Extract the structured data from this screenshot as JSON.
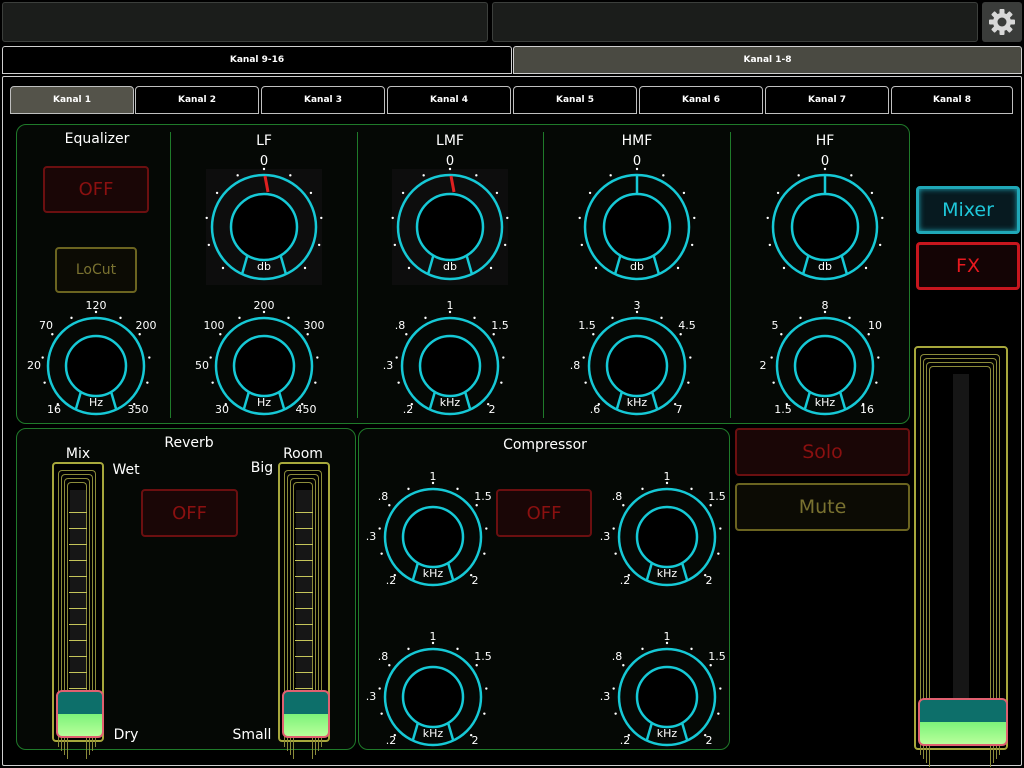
{
  "header": {
    "settings_icon": "gear-icon"
  },
  "group_tabs": [
    {
      "label": "Kanal 9-16",
      "active": false
    },
    {
      "label": "Kanal 1-8",
      "active": true
    }
  ],
  "channel_tabs": [
    "Kanal 1",
    "Kanal 2",
    "Kanal 3",
    "Kanal 4",
    "Kanal 5",
    "Kanal 6",
    "Kanal 7",
    "Kanal 8"
  ],
  "equalizer": {
    "title": "Equalizer",
    "off_label": "OFF",
    "locut_label": "LoCut",
    "freq_knob": {
      "unit": "Hz",
      "ticks": [
        "20",
        "70",
        "120",
        "200",
        "16",
        "350"
      ]
    },
    "bands": [
      {
        "name": "LF",
        "gain_value": "0",
        "gain_unit": "db",
        "freq_unit": "Hz",
        "freq_ticks": [
          "50",
          "100",
          "200",
          "300",
          "30",
          "450"
        ]
      },
      {
        "name": "LMF",
        "gain_value": "0",
        "gain_unit": "db",
        "freq_unit": "kHz",
        "freq_ticks": [
          ".3",
          ".8",
          "1",
          "1.5",
          ".2",
          "2"
        ]
      },
      {
        "name": "HMF",
        "gain_value": "0",
        "gain_unit": "db",
        "freq_unit": "kHz",
        "freq_ticks": [
          ".8",
          "1.5",
          "3",
          "4.5",
          ".6",
          "7"
        ]
      },
      {
        "name": "HF",
        "gain_value": "0",
        "gain_unit": "db",
        "freq_unit": "kHz",
        "freq_ticks": [
          "2",
          "5",
          "8",
          "10",
          "1.5",
          "16"
        ]
      }
    ]
  },
  "reverb": {
    "title": "Reverb",
    "off_label": "OFF",
    "mix": {
      "label": "Mix",
      "top": "Wet",
      "bottom": "Dry"
    },
    "room": {
      "label": "Room",
      "top": "Big",
      "bottom": "Small"
    }
  },
  "compressor": {
    "title": "Compressor",
    "off_label": "OFF",
    "knobs": [
      {
        "unit": "kHz",
        "ticks": [
          ".3",
          ".8",
          "1",
          "1.5",
          ".2",
          "2"
        ]
      },
      {
        "unit": "kHz",
        "ticks": [
          ".3",
          ".8",
          "1",
          "1.5",
          ".2",
          "2"
        ]
      },
      {
        "unit": "kHz",
        "ticks": [
          ".3",
          ".8",
          "1",
          "1.5",
          ".2",
          "2"
        ]
      },
      {
        "unit": "kHz",
        "ticks": [
          ".3",
          ".8",
          "1",
          "1.5",
          ".2",
          "2"
        ]
      }
    ]
  },
  "side": {
    "mixer_label": "Mixer",
    "fx_label": "FX",
    "solo_label": "Solo",
    "mute_label": "Mute"
  }
}
